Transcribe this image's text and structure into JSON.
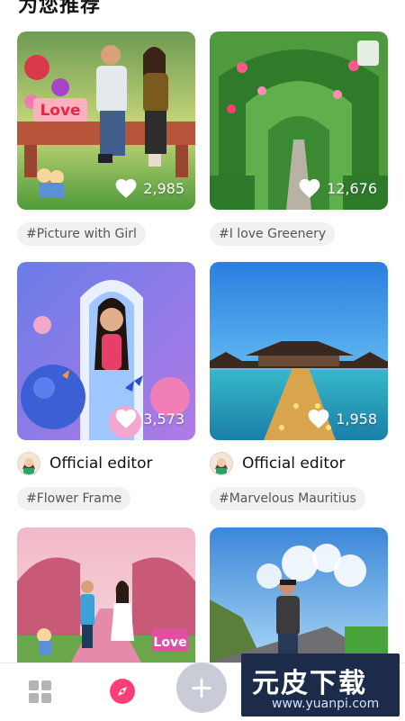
{
  "header": {
    "title": "为您推荐"
  },
  "cards": [
    {
      "tag": "#Picture with Girl",
      "likes": "2,985",
      "editor": ""
    },
    {
      "tag": "#I love Greenery",
      "likes": "12,676",
      "editor": ""
    },
    {
      "tag": "#Flower Frame",
      "likes": "3,573",
      "editor": "Official editor"
    },
    {
      "tag": "#Marvelous Mauritius",
      "likes": "1,958",
      "editor": "Official editor"
    },
    {
      "tag": "",
      "likes": "",
      "editor": ""
    },
    {
      "tag": "",
      "likes": "",
      "editor": ""
    }
  ],
  "thumbs": {
    "love": "Love",
    "sign": "Love"
  },
  "bottom_nav": {
    "add_label": "+",
    "active_color": "#ff3e78",
    "inactive_color": "#b4b4b4"
  },
  "watermark": {
    "main": "元皮下载",
    "sub": "www.yuanpi.com"
  },
  "icons": [
    "heart-icon",
    "grid-icon",
    "compass-icon",
    "plus-icon"
  ]
}
